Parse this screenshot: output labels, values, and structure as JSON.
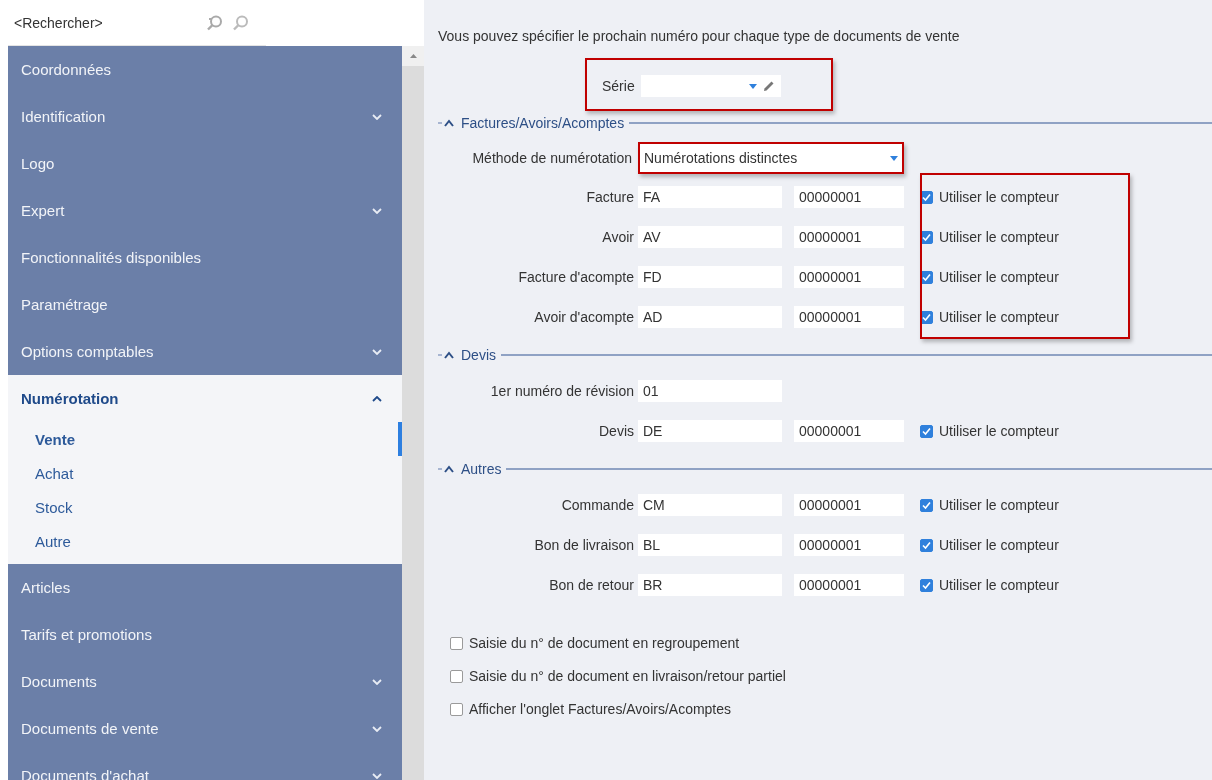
{
  "search": {
    "placeholder": "<Rechercher>"
  },
  "sidebar": {
    "items": [
      {
        "label": "Coordonnées",
        "has_children": false,
        "expanded": false
      },
      {
        "label": "Identification",
        "has_children": true,
        "expanded": false
      },
      {
        "label": "Logo",
        "has_children": false,
        "expanded": false
      },
      {
        "label": "Expert",
        "has_children": true,
        "expanded": false
      },
      {
        "label": "Fonctionnalités disponibles",
        "has_children": false,
        "expanded": false
      },
      {
        "label": "Paramétrage",
        "has_children": false,
        "expanded": false
      },
      {
        "label": "Options comptables",
        "has_children": true,
        "expanded": false
      },
      {
        "label": "Numérotation",
        "has_children": true,
        "expanded": true,
        "children": [
          {
            "label": "Vente",
            "selected": true
          },
          {
            "label": "Achat",
            "selected": false
          },
          {
            "label": "Stock",
            "selected": false
          },
          {
            "label": "Autre",
            "selected": false
          }
        ]
      },
      {
        "label": "Articles",
        "has_children": false,
        "expanded": false
      },
      {
        "label": "Tarifs et promotions",
        "has_children": false,
        "expanded": false
      },
      {
        "label": "Documents",
        "has_children": true,
        "expanded": false
      },
      {
        "label": "Documents de vente",
        "has_children": true,
        "expanded": false
      },
      {
        "label": "Documents d'achat",
        "has_children": true,
        "expanded": false
      }
    ]
  },
  "intro": "Vous pouvez spécifier le prochain numéro pour chaque type de documents de vente",
  "serie": {
    "label": "Série",
    "highlighted": true
  },
  "sections": [
    {
      "title": "Factures/Avoirs/Acomptes",
      "expanded": true,
      "counters_highlighted": true,
      "rows": [
        {
          "kind": "method",
          "label": "Méthode de numérotation",
          "value": "Numérotations distinctes",
          "highlighted": true
        },
        {
          "kind": "counter",
          "label": "Facture",
          "prefix": "FA",
          "number": "00000001",
          "counter_label": "Utiliser le compteur",
          "checked": true
        },
        {
          "kind": "counter",
          "label": "Avoir",
          "prefix": "AV",
          "number": "00000001",
          "counter_label": "Utiliser le compteur",
          "checked": true
        },
        {
          "kind": "counter",
          "label": "Facture d'acompte",
          "prefix": "FD",
          "number": "00000001",
          "counter_label": "Utiliser le compteur",
          "checked": true
        },
        {
          "kind": "counter",
          "label": "Avoir d'acompte",
          "prefix": "AD",
          "number": "00000001",
          "counter_label": "Utiliser le compteur",
          "checked": true
        }
      ]
    },
    {
      "title": "Devis",
      "expanded": true,
      "counters_highlighted": false,
      "rows": [
        {
          "kind": "revision",
          "label": "1er numéro de révision",
          "value": "01"
        },
        {
          "kind": "counter",
          "label": "Devis",
          "prefix": "DE",
          "number": "00000001",
          "counter_label": "Utiliser le compteur",
          "checked": true
        }
      ]
    },
    {
      "title": "Autres",
      "expanded": true,
      "counters_highlighted": false,
      "rows": [
        {
          "kind": "counter",
          "label": "Commande",
          "prefix": "CM",
          "number": "00000001",
          "counter_label": "Utiliser le compteur",
          "checked": true
        },
        {
          "kind": "counter",
          "label": "Bon de livraison",
          "prefix": "BL",
          "number": "00000001",
          "counter_label": "Utiliser le compteur",
          "checked": true
        },
        {
          "kind": "counter",
          "label": "Bon de retour",
          "prefix": "BR",
          "number": "00000001",
          "counter_label": "Utiliser le compteur",
          "checked": true
        }
      ]
    }
  ],
  "options": [
    {
      "label": "Saisie du n° de document en regroupement",
      "checked": false
    },
    {
      "label": "Saisie du n° de document en livraison/retour partiel",
      "checked": false
    },
    {
      "label": "Afficher l'onglet Factures/Avoirs/Acomptes",
      "checked": false
    }
  ]
}
